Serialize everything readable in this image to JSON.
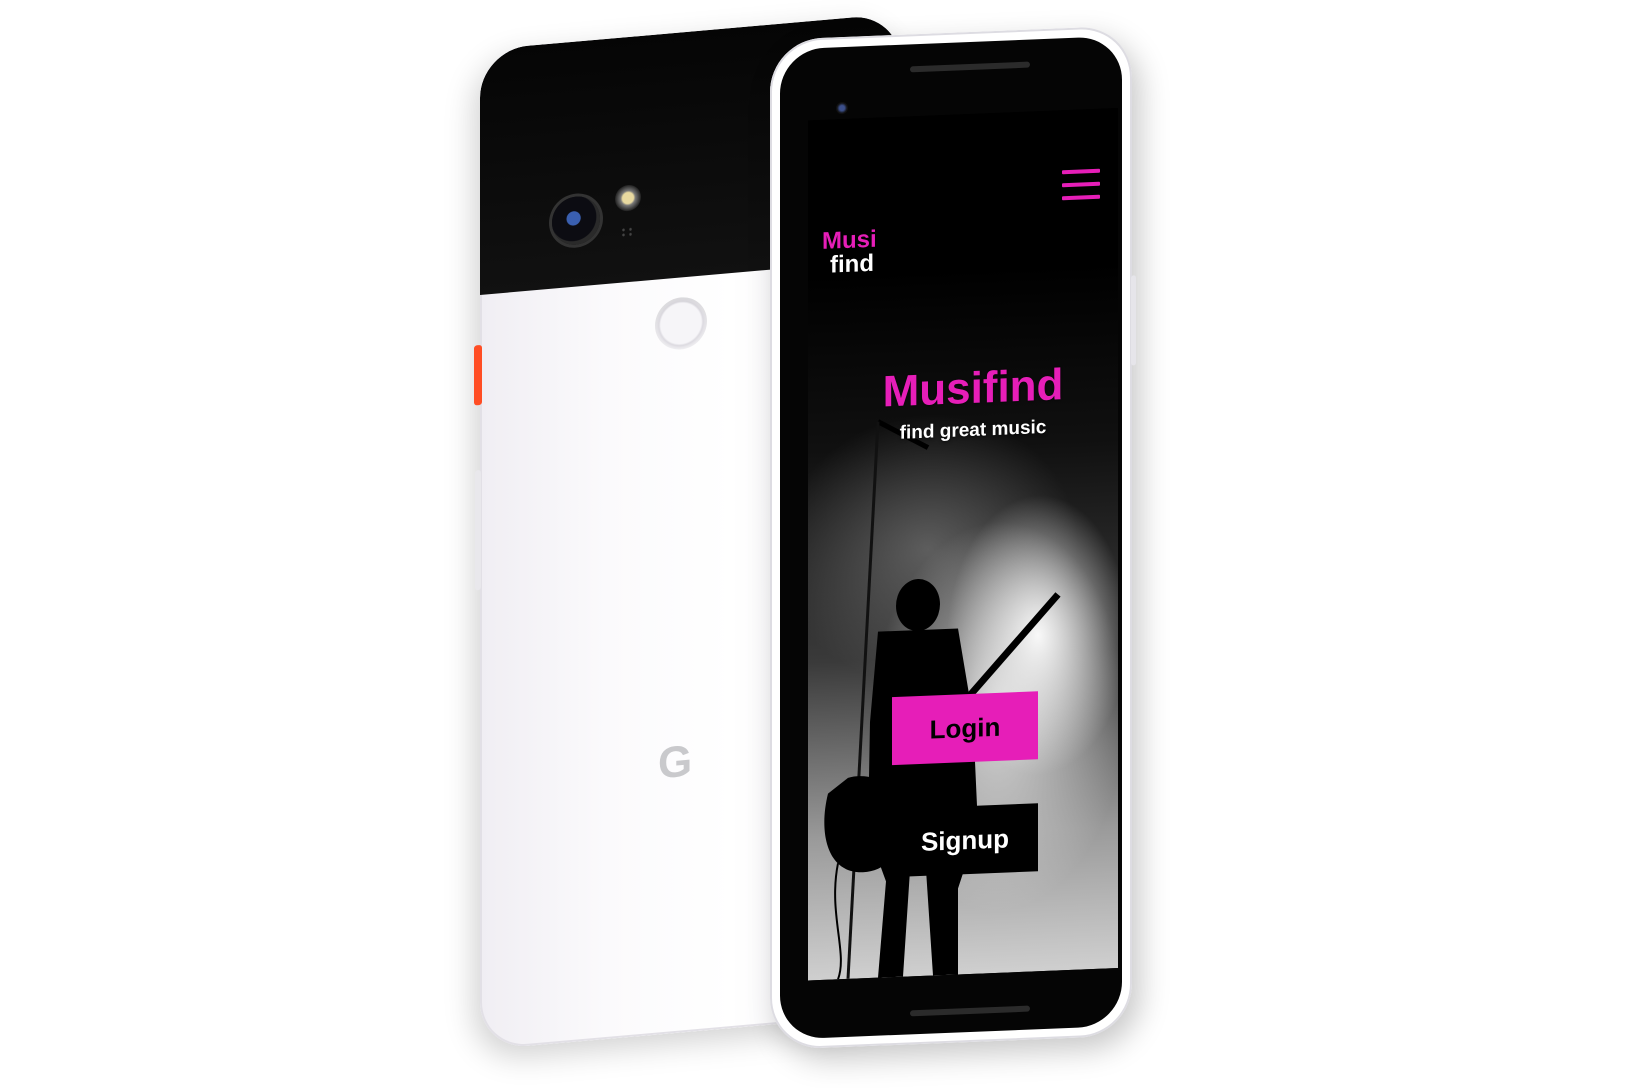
{
  "app": {
    "logo_top": "Musi",
    "logo_bottom": "find",
    "menu_icon": "hamburger-menu-icon"
  },
  "hero": {
    "title": "Musifind",
    "subtitle": "find great music"
  },
  "actions": {
    "login_label": "Login",
    "signup_label": "Signup"
  },
  "device_back": {
    "brand_glyph": "G"
  },
  "colors": {
    "accent": "#e61eb8",
    "background": "#000000",
    "text_light": "#ffffff"
  }
}
